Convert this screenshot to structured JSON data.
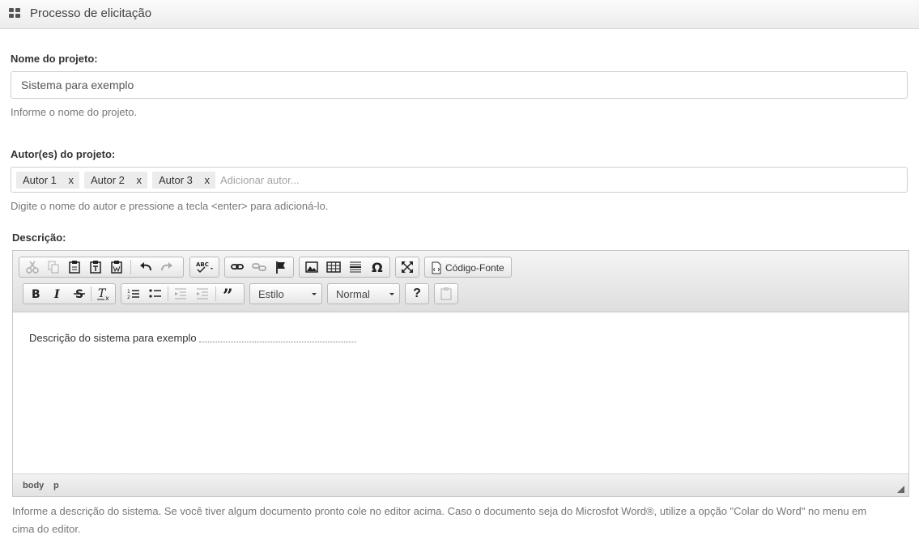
{
  "header": {
    "title": "Processo de elicitação",
    "icon": "grid-icon"
  },
  "project_name": {
    "label": "Nome do projeto:",
    "value": "Sistema para exemplo",
    "help": "Informe o nome do projeto."
  },
  "authors": {
    "label": "Autor(es) do projeto:",
    "tags": [
      "Autor 1",
      "Autor 2",
      "Autor 3"
    ],
    "remove_label": "x",
    "placeholder": "Adicionar autor...",
    "help": "Digite o nome do autor e pressione a tecla <enter> para adicioná-lo."
  },
  "description": {
    "label": "Descrição:",
    "content": "Descrição do sistema para exemplo",
    "help_line1": "Informe a descrição do sistema. Se você tiver algum documento pronto cole no editor acima. Caso o documento seja do Microsfot Word®, utilize a opção \"Colar do Word\" no menu em",
    "help_line2": "cima do editor."
  },
  "editor": {
    "source_button": "Código-Fonte",
    "style_combo": "Estilo",
    "format_combo": "Normal",
    "help_button": "?",
    "status_path": [
      "body",
      "p"
    ]
  }
}
